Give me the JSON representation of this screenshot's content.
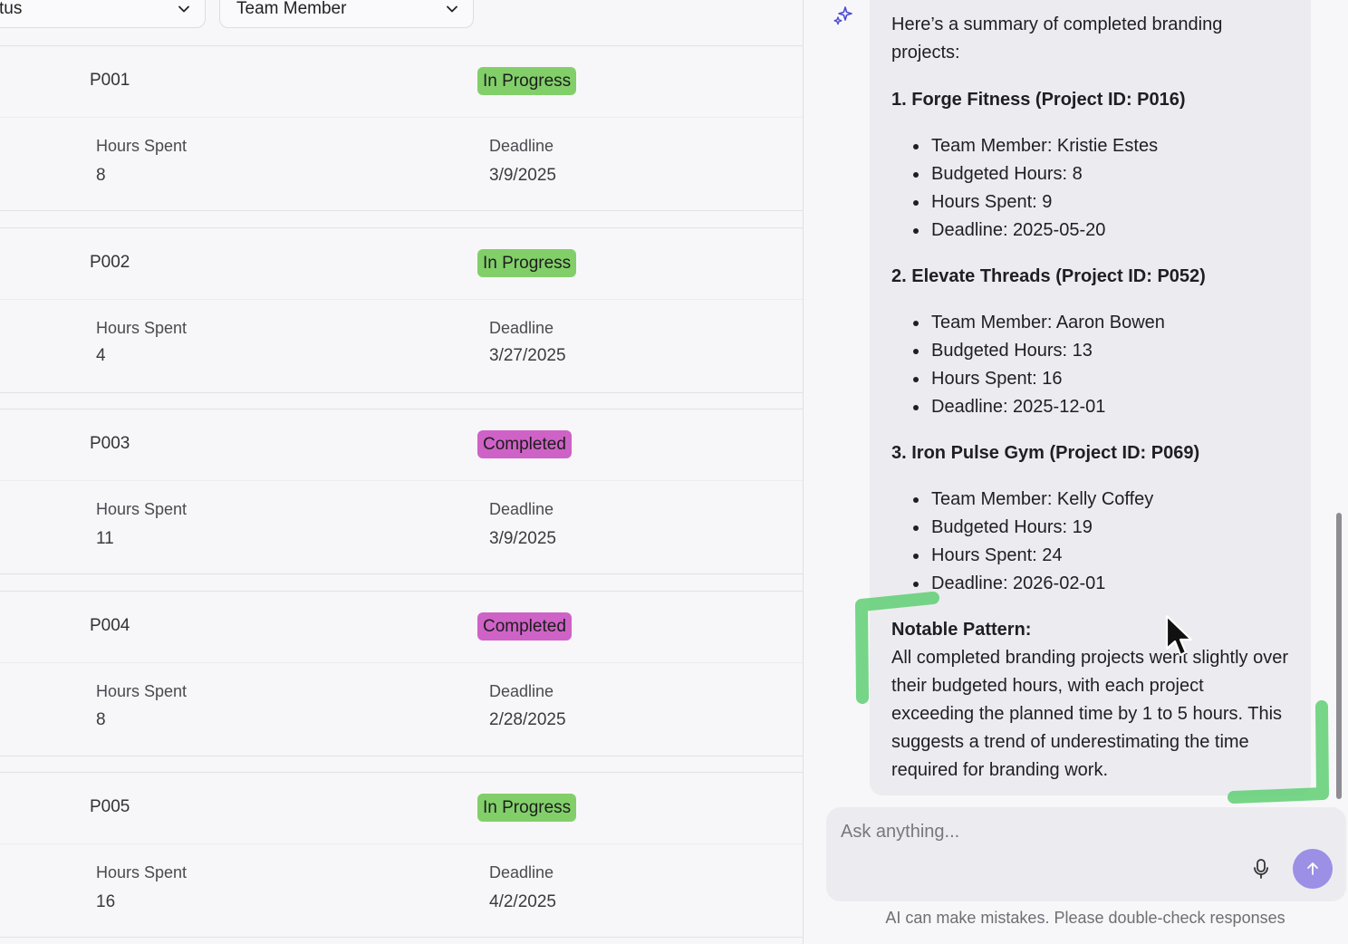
{
  "filters": {
    "status_label": "tus",
    "member_label": "Team Member"
  },
  "projects": [
    {
      "id": "P001",
      "status": "In Progress",
      "hours_label": "Hours Spent",
      "hours": "8",
      "deadline_label": "Deadline",
      "deadline": "3/9/2025"
    },
    {
      "id": "P002",
      "status": "In Progress",
      "hours_label": "Hours Spent",
      "hours": "4",
      "deadline_label": "Deadline",
      "deadline": "3/27/2025"
    },
    {
      "id": "P003",
      "status": "Completed",
      "hours_label": "Hours Spent",
      "hours": "11",
      "deadline_label": "Deadline",
      "deadline": "3/9/2025"
    },
    {
      "id": "P004",
      "status": "Completed",
      "hours_label": "Hours Spent",
      "hours": "8",
      "deadline_label": "Deadline",
      "deadline": "2/28/2025"
    },
    {
      "id": "P005",
      "status": "In Progress",
      "hours_label": "Hours Spent",
      "hours": "16",
      "deadline_label": "Deadline",
      "deadline": "4/2/2025"
    }
  ],
  "status_colors": {
    "In Progress": "#82cf6a",
    "Completed": "#cf62c6"
  },
  "chat": {
    "intro": "Here’s a summary of completed branding projects:",
    "items": [
      {
        "title": "1. Forge Fitness (Project ID: P016)",
        "bullets": [
          "Team Member: Kristie Estes",
          "Budgeted Hours: 8",
          "Hours Spent: 9",
          "Deadline: 2025-05-20"
        ]
      },
      {
        "title": "2. Elevate Threads (Project ID: P052)",
        "bullets": [
          "Team Member: Aaron Bowen",
          "Budgeted Hours: 13",
          "Hours Spent: 16",
          "Deadline: 2025-12-01"
        ]
      },
      {
        "title": "3. Iron Pulse Gym (Project ID: P069)",
        "bullets": [
          "Team Member: Kelly Coffey",
          "Budgeted Hours: 19",
          "Hours Spent: 24",
          "Deadline: 2026-02-01"
        ]
      }
    ],
    "notable_title": "Notable Pattern:",
    "notable_text": "All completed branding projects went slightly over their budgeted hours, with each project exceeding the planned time by 1 to 5 hours. This suggests a trend of underestimating the time required for branding work."
  },
  "composer": {
    "placeholder": "Ask anything...",
    "disclaimer": "AI can make mistakes. Please double-check responses"
  },
  "icons": {
    "ai": "sparkle-icon",
    "mic": "microphone-icon",
    "send": "arrow-up-icon",
    "filter_chevron": "chevron-down-icon"
  },
  "accent_color": "#9b8fe6"
}
